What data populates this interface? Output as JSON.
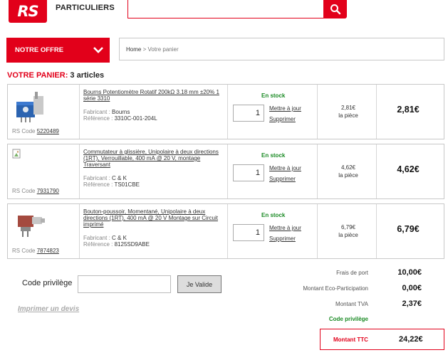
{
  "header": {
    "logo_text": "RS",
    "section": "PARTICULIERS",
    "search_placeholder": ""
  },
  "offer_button": "NOTRE OFFRE",
  "breadcrumb": {
    "home": "Home",
    "separator": ">",
    "current": "Votre panier"
  },
  "cart_title": {
    "label": "VOTRE PANIER:",
    "count": "3 articles"
  },
  "labels": {
    "rs_code": "RS Code",
    "fabricant": "Fabricant :",
    "reference": "Référence :",
    "in_stock": "En stock",
    "update": "Mettre à jour",
    "remove": "Supprimer",
    "per_piece": "la pièce"
  },
  "items": [
    {
      "title": "Bourns Potentiomètre Rotatif 200kΩ 3.18 mm ±20% 1 série 3310",
      "rs_code": "5220489",
      "fabricant": "Bourns",
      "reference": "3310C-001-204L",
      "quantity": "1",
      "unit_price": "2,81€",
      "total": "2,81€",
      "image": "potentiometer-image"
    },
    {
      "title": "Commutateur à glissière, Unipolaire à deux directions (1RT), Verrouillable, 400 mA @ 20 V, montage Traversant",
      "rs_code": "7931790",
      "fabricant": "C & K",
      "reference": "TS01CBE",
      "quantity": "1",
      "unit_price": "4,62€",
      "total": "4,62€",
      "image": "broken-image"
    },
    {
      "title": "Bouton-poussoir, Momentané, Unipolaire à deux directions (1RT), 400 mA @ 20 V Montage sur Circuit imprimé",
      "rs_code": "7874823",
      "fabricant": "C & K",
      "reference": "8125SD9ABE",
      "quantity": "1",
      "unit_price": "6,79€",
      "total": "6,79€",
      "image": "push-button-image"
    }
  ],
  "promo": {
    "label": "Code privilège",
    "input_value": "",
    "button": "Je Valide",
    "print_quote": "Imprimer un devis"
  },
  "totals": {
    "shipping_label": "Frais de port",
    "shipping": "10,00€",
    "eco_label": "Montant Eco-Participation",
    "eco": "0,00€",
    "tva_label": "Montant TVA",
    "tva": "2,37€",
    "promo_label": "Code privilège",
    "ttc_label": "Montant TTC",
    "ttc": "24,22€"
  },
  "colors": {
    "brand": "#e2001a",
    "stock": "#1a8a24"
  }
}
